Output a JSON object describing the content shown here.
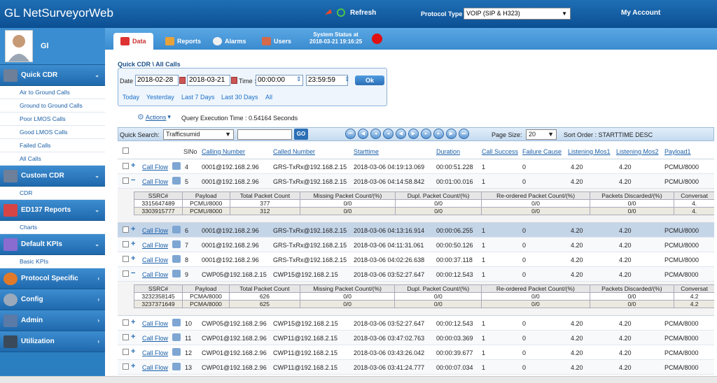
{
  "app": {
    "title": "GL NetSurveyorWeb",
    "refresh_label": "Refresh",
    "protocol_label": "Protocol Type",
    "protocol_value": "VOIP (SIP & H323)",
    "my_account": "My Account"
  },
  "user": {
    "name": "Gl"
  },
  "sidebar": {
    "sections": [
      {
        "label": "Quick CDR",
        "items": [
          "Air to Ground Calls",
          "Ground to Ground Calls",
          "Poor LMOS Calls",
          "Good LMOS Calls",
          "Failed Calls",
          "All Calls"
        ]
      },
      {
        "label": "Custom CDR",
        "items": [
          "CDR"
        ]
      },
      {
        "label": "ED137 Reports",
        "items": [
          "Charts"
        ]
      },
      {
        "label": "Default KPIs",
        "items": [
          "Basic KPIs"
        ]
      },
      {
        "label": "Protocol Specific",
        "items": []
      },
      {
        "label": "Config",
        "items": []
      },
      {
        "label": "Admin",
        "items": []
      },
      {
        "label": "Utilization",
        "items": []
      }
    ]
  },
  "tabs": [
    "Data",
    "Reports",
    "Alarms",
    "Users"
  ],
  "system_status": {
    "line1": "System Status at",
    "line2": "2018-03-21 19:16:25"
  },
  "query": {
    "breadcrumb": "Quick CDR \\ All Calls",
    "date_label": "Date :",
    "date_from": "2018-02-28",
    "date_to": "2018-03-21",
    "time_label": "Time :",
    "time_from": "00:00:00",
    "time_to": "23:59:59",
    "ok_label": "Ok",
    "quick_links": [
      "Today",
      "Yesterday",
      "Last 7 Days",
      "Last 30 Days",
      "All"
    ],
    "actions_label": "Actions",
    "execution_time": "Query Execution Time : 0.54164 Seconds"
  },
  "search": {
    "label": "Quick Search:",
    "field": "Trafficsumid",
    "go_label": "GO",
    "page_size_label": "Page Size:",
    "page_size": "20",
    "sort_order": "Sort Order : STARTTIME DESC"
  },
  "columns": [
    "SlNo",
    "Calling Number",
    "Called Number",
    "Starttime",
    "Duration",
    "Call Success",
    "Failure Cause",
    "Listening Mos1",
    "Listening Mos2",
    "Payload1"
  ],
  "callflow_label": "Call Flow",
  "rows": [
    {
      "slno": "4",
      "calling": "0001@192.168.2.96",
      "called": "GRS-TxRx@192.168.2.15",
      "start": "2018-03-06 04:19:13.069",
      "duration": "00:00:51.228",
      "success": "1",
      "failure": "0",
      "mos1": "4.20",
      "mos2": "4.20",
      "payload": "PCMU/8000"
    },
    {
      "slno": "5",
      "calling": "0001@192.168.2.96",
      "called": "GRS-TxRx@192.168.2.15",
      "start": "2018-03-06 04:14:58.842",
      "duration": "00:01:00.016",
      "success": "1",
      "failure": "0",
      "mos1": "4.20",
      "mos2": "4.20",
      "payload": "PCMU/8000"
    },
    {
      "slno": "6",
      "calling": "0001@192.168.2.96",
      "called": "GRS-TxRx@192.168.2.15",
      "start": "2018-03-06 04:13:16.914",
      "duration": "00:00:06.255",
      "success": "1",
      "failure": "0",
      "mos1": "4.20",
      "mos2": "4.20",
      "payload": "PCMU/8000"
    },
    {
      "slno": "7",
      "calling": "0001@192.168.2.96",
      "called": "GRS-TxRx@192.168.2.15",
      "start": "2018-03-06 04:11:31.061",
      "duration": "00:00:50.126",
      "success": "1",
      "failure": "0",
      "mos1": "4.20",
      "mos2": "4.20",
      "payload": "PCMU/8000"
    },
    {
      "slno": "8",
      "calling": "0001@192.168.2.96",
      "called": "GRS-TxRx@192.168.2.15",
      "start": "2018-03-06 04:02:26.638",
      "duration": "00:00:37.118",
      "success": "1",
      "failure": "0",
      "mos1": "4.20",
      "mos2": "4.20",
      "payload": "PCMU/8000"
    },
    {
      "slno": "9",
      "calling": "CWP05@192.168.2.15",
      "called": "CWP15@192.168.2.15",
      "start": "2018-03-06 03:52:27.647",
      "duration": "00:00:12.543",
      "success": "1",
      "failure": "0",
      "mos1": "4.20",
      "mos2": "4.20",
      "payload": "PCMA/8000"
    },
    {
      "slno": "10",
      "calling": "CWP05@192.168.2.96",
      "called": "CWP15@192.168.2.15",
      "start": "2018-03-06 03:52:27.647",
      "duration": "00:00:12.543",
      "success": "1",
      "failure": "0",
      "mos1": "4.20",
      "mos2": "4.20",
      "payload": "PCMA/8000"
    },
    {
      "slno": "11",
      "calling": "CWP01@192.168.2.96",
      "called": "CWP11@192.168.2.15",
      "start": "2018-03-06 03:47:02.763",
      "duration": "00:00:03.369",
      "success": "1",
      "failure": "0",
      "mos1": "4.20",
      "mos2": "4.20",
      "payload": "PCMA/8000"
    },
    {
      "slno": "12",
      "calling": "CWP01@192.168.2.96",
      "called": "CWP11@192.168.2.15",
      "start": "2018-03-06 03:43:26.042",
      "duration": "00:00:39.677",
      "success": "1",
      "failure": "0",
      "mos1": "4.20",
      "mos2": "4.20",
      "payload": "PCMA/8000"
    },
    {
      "slno": "13",
      "calling": "CWP01@192.168.2.96",
      "called": "CWP11@192.168.2.15",
      "start": "2018-03-06 03:41:24.777",
      "duration": "00:00:07.034",
      "success": "1",
      "failure": "0",
      "mos1": "4.20",
      "mos2": "4.20",
      "payload": "PCMA/8000"
    }
  ],
  "detail_columns": [
    "SSRC#",
    "Payload",
    "Total Packet Count",
    "Missing Packet Count/(%)",
    "Dupl. Packet Count/(%)",
    "Re-ordered Packet Count/(%)",
    "Packets Discarded/(%)",
    "Conversat"
  ],
  "detail_5": [
    [
      "3315647489",
      "PCMU/8000",
      "377",
      "0/0",
      "0/0",
      "0/0",
      "0/0",
      "4."
    ],
    [
      "3303915777",
      "PCMU/8000",
      "312",
      "0/0",
      "0/0",
      "0/0",
      "0/0",
      "4."
    ]
  ],
  "detail_9": [
    [
      "3232358145",
      "PCMA/8000",
      "626",
      "0/0",
      "0/0",
      "0/0",
      "0/0",
      "4.2"
    ],
    [
      "3237371649",
      "PCMA/8000",
      "625",
      "0/0",
      "0/0",
      "0/0",
      "0/0",
      "4.2"
    ]
  ]
}
